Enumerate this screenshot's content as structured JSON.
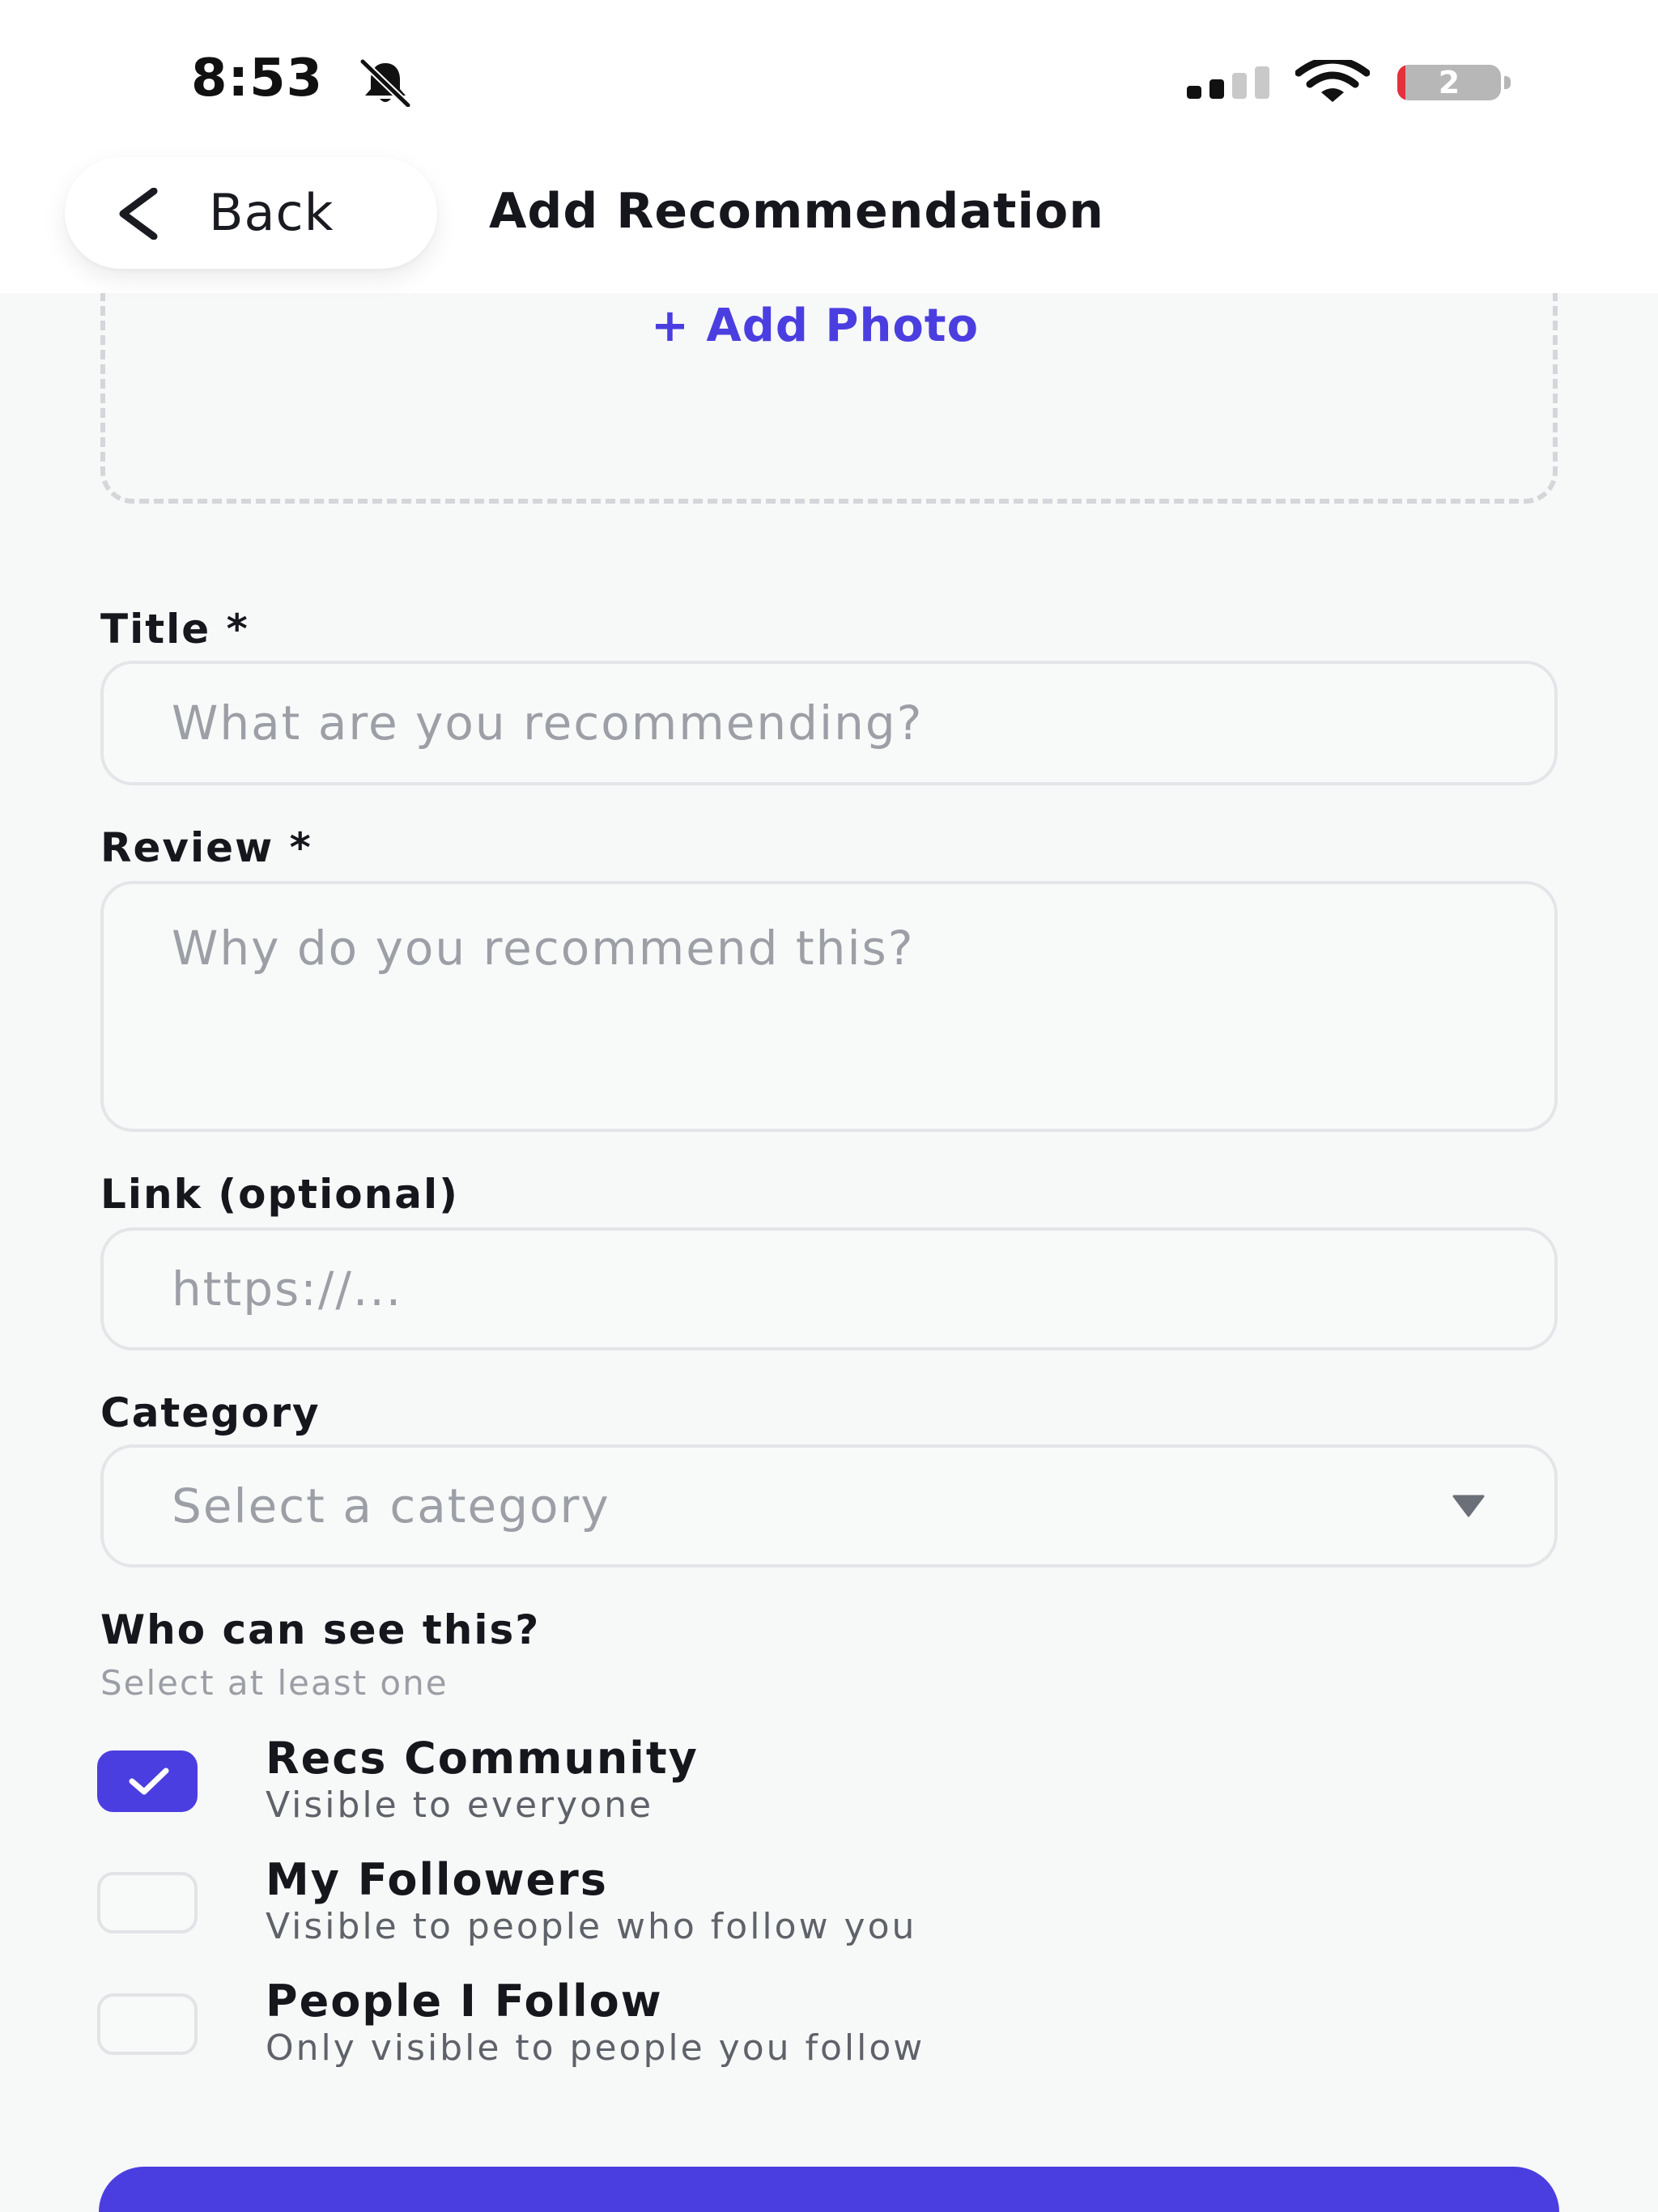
{
  "status_bar": {
    "time": "8:53",
    "silent_icon": "bell-slash-icon",
    "signal_icon": "cellular-signal-icon",
    "wifi_icon": "wifi-icon",
    "battery_icon": "battery-icon",
    "battery_level": "2"
  },
  "header": {
    "back_label": "Back",
    "back_icon": "chevron-left-icon",
    "title": "Add Recommendation"
  },
  "photo": {
    "add_label": "+ Add Photo"
  },
  "form": {
    "title": {
      "label": "Title *",
      "value": "",
      "placeholder": "What are you recommending?"
    },
    "review": {
      "label": "Review *",
      "value": "",
      "placeholder": "Why do you recommend this?"
    },
    "link": {
      "label": "Link (optional)",
      "value": "",
      "placeholder": "https://..."
    },
    "category": {
      "label": "Category",
      "selected": "Select a category",
      "icon": "caret-down-icon"
    }
  },
  "visibility": {
    "heading": "Who can see this?",
    "hint": "Select at least one",
    "options": [
      {
        "title": "Recs Community",
        "subtitle": "Visible to everyone",
        "checked": true
      },
      {
        "title": "My Followers",
        "subtitle": "Visible to people who follow you",
        "checked": false
      },
      {
        "title": "People I Follow",
        "subtitle": "Only visible to people you follow",
        "checked": false
      }
    ]
  },
  "colors": {
    "accent": "#4b3ee0",
    "background": "#f7f8f8",
    "input_border": "#e3e5e8",
    "placeholder": "#9d9fa6",
    "battery_low": "#e4313a"
  }
}
